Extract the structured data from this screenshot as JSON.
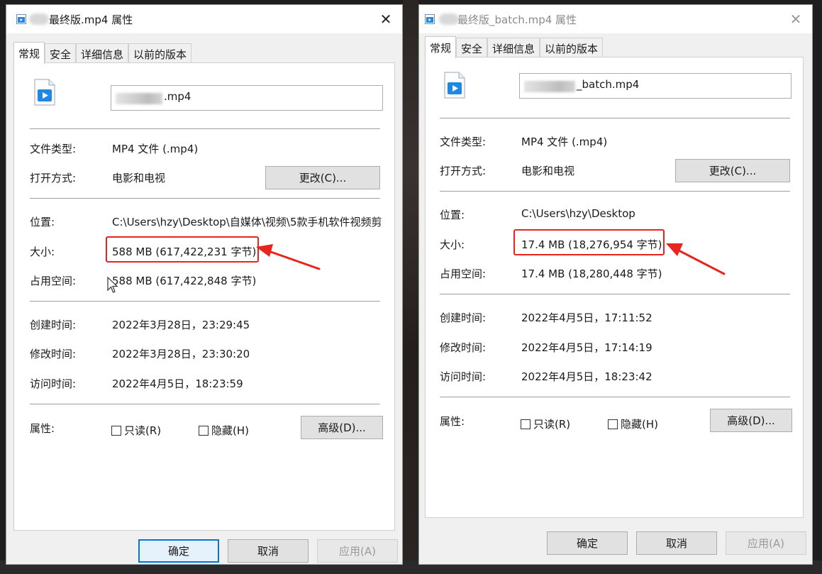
{
  "left_dialog": {
    "title": "最终版.mp4 属性",
    "tabs": [
      "常规",
      "安全",
      "详细信息",
      "以前的版本"
    ],
    "file_name": ".mp4",
    "labels": {
      "file_type": "文件类型:",
      "open_with": "打开方式:",
      "location": "位置:",
      "size": "大小:",
      "size_on_disk": "占用空间:",
      "created": "创建时间:",
      "modified": "修改时间:",
      "accessed": "访问时间:",
      "attributes": "属性:"
    },
    "values": {
      "file_type": "MP4 文件 (.mp4)",
      "open_with": "电影和电视",
      "location": "C:\\Users\\hzy\\Desktop\\自媒体\\视频\\5款手机软件视频剪",
      "size": "588 MB (617,422,231 字节)",
      "size_on_disk": "588 MB (617,422,848 字节)",
      "created": "2022年3月28日，23:29:45",
      "modified": "2022年3月28日，23:30:20",
      "accessed": "2022年4月5日，18:23:59"
    },
    "change_button": "更改(C)...",
    "readonly_label": "只读(R)",
    "hidden_label": "隐藏(H)",
    "advanced_button": "高级(D)...",
    "ok_button": "确定",
    "cancel_button": "取消",
    "apply_button": "应用(A)"
  },
  "right_dialog": {
    "title": "最终版_batch.mp4 属性",
    "tabs": [
      "常规",
      "安全",
      "详细信息",
      "以前的版本"
    ],
    "file_name": "_batch.mp4",
    "labels": {
      "file_type": "文件类型:",
      "open_with": "打开方式:",
      "location": "位置:",
      "size": "大小:",
      "size_on_disk": "占用空间:",
      "created": "创建时间:",
      "modified": "修改时间:",
      "accessed": "访问时间:",
      "attributes": "属性:"
    },
    "values": {
      "file_type": "MP4 文件 (.mp4)",
      "open_with": "电影和电视",
      "location": "C:\\Users\\hzy\\Desktop",
      "size": "17.4 MB (18,276,954 字节)",
      "size_on_disk": "17.4 MB (18,280,448 字节)",
      "created": "2022年4月5日，17:11:52",
      "modified": "2022年4月5日，17:14:19",
      "accessed": "2022年4月5日，18:23:42"
    },
    "change_button": "更改(C)...",
    "readonly_label": "只读(R)",
    "hidden_label": "隐藏(H)",
    "advanced_button": "高级(D)...",
    "ok_button": "确定",
    "cancel_button": "取消",
    "apply_button": "应用(A)"
  },
  "colors": {
    "highlight": "#e8251c",
    "focus_blue": "#0078d7",
    "icon_blue": "#1e88e5"
  }
}
